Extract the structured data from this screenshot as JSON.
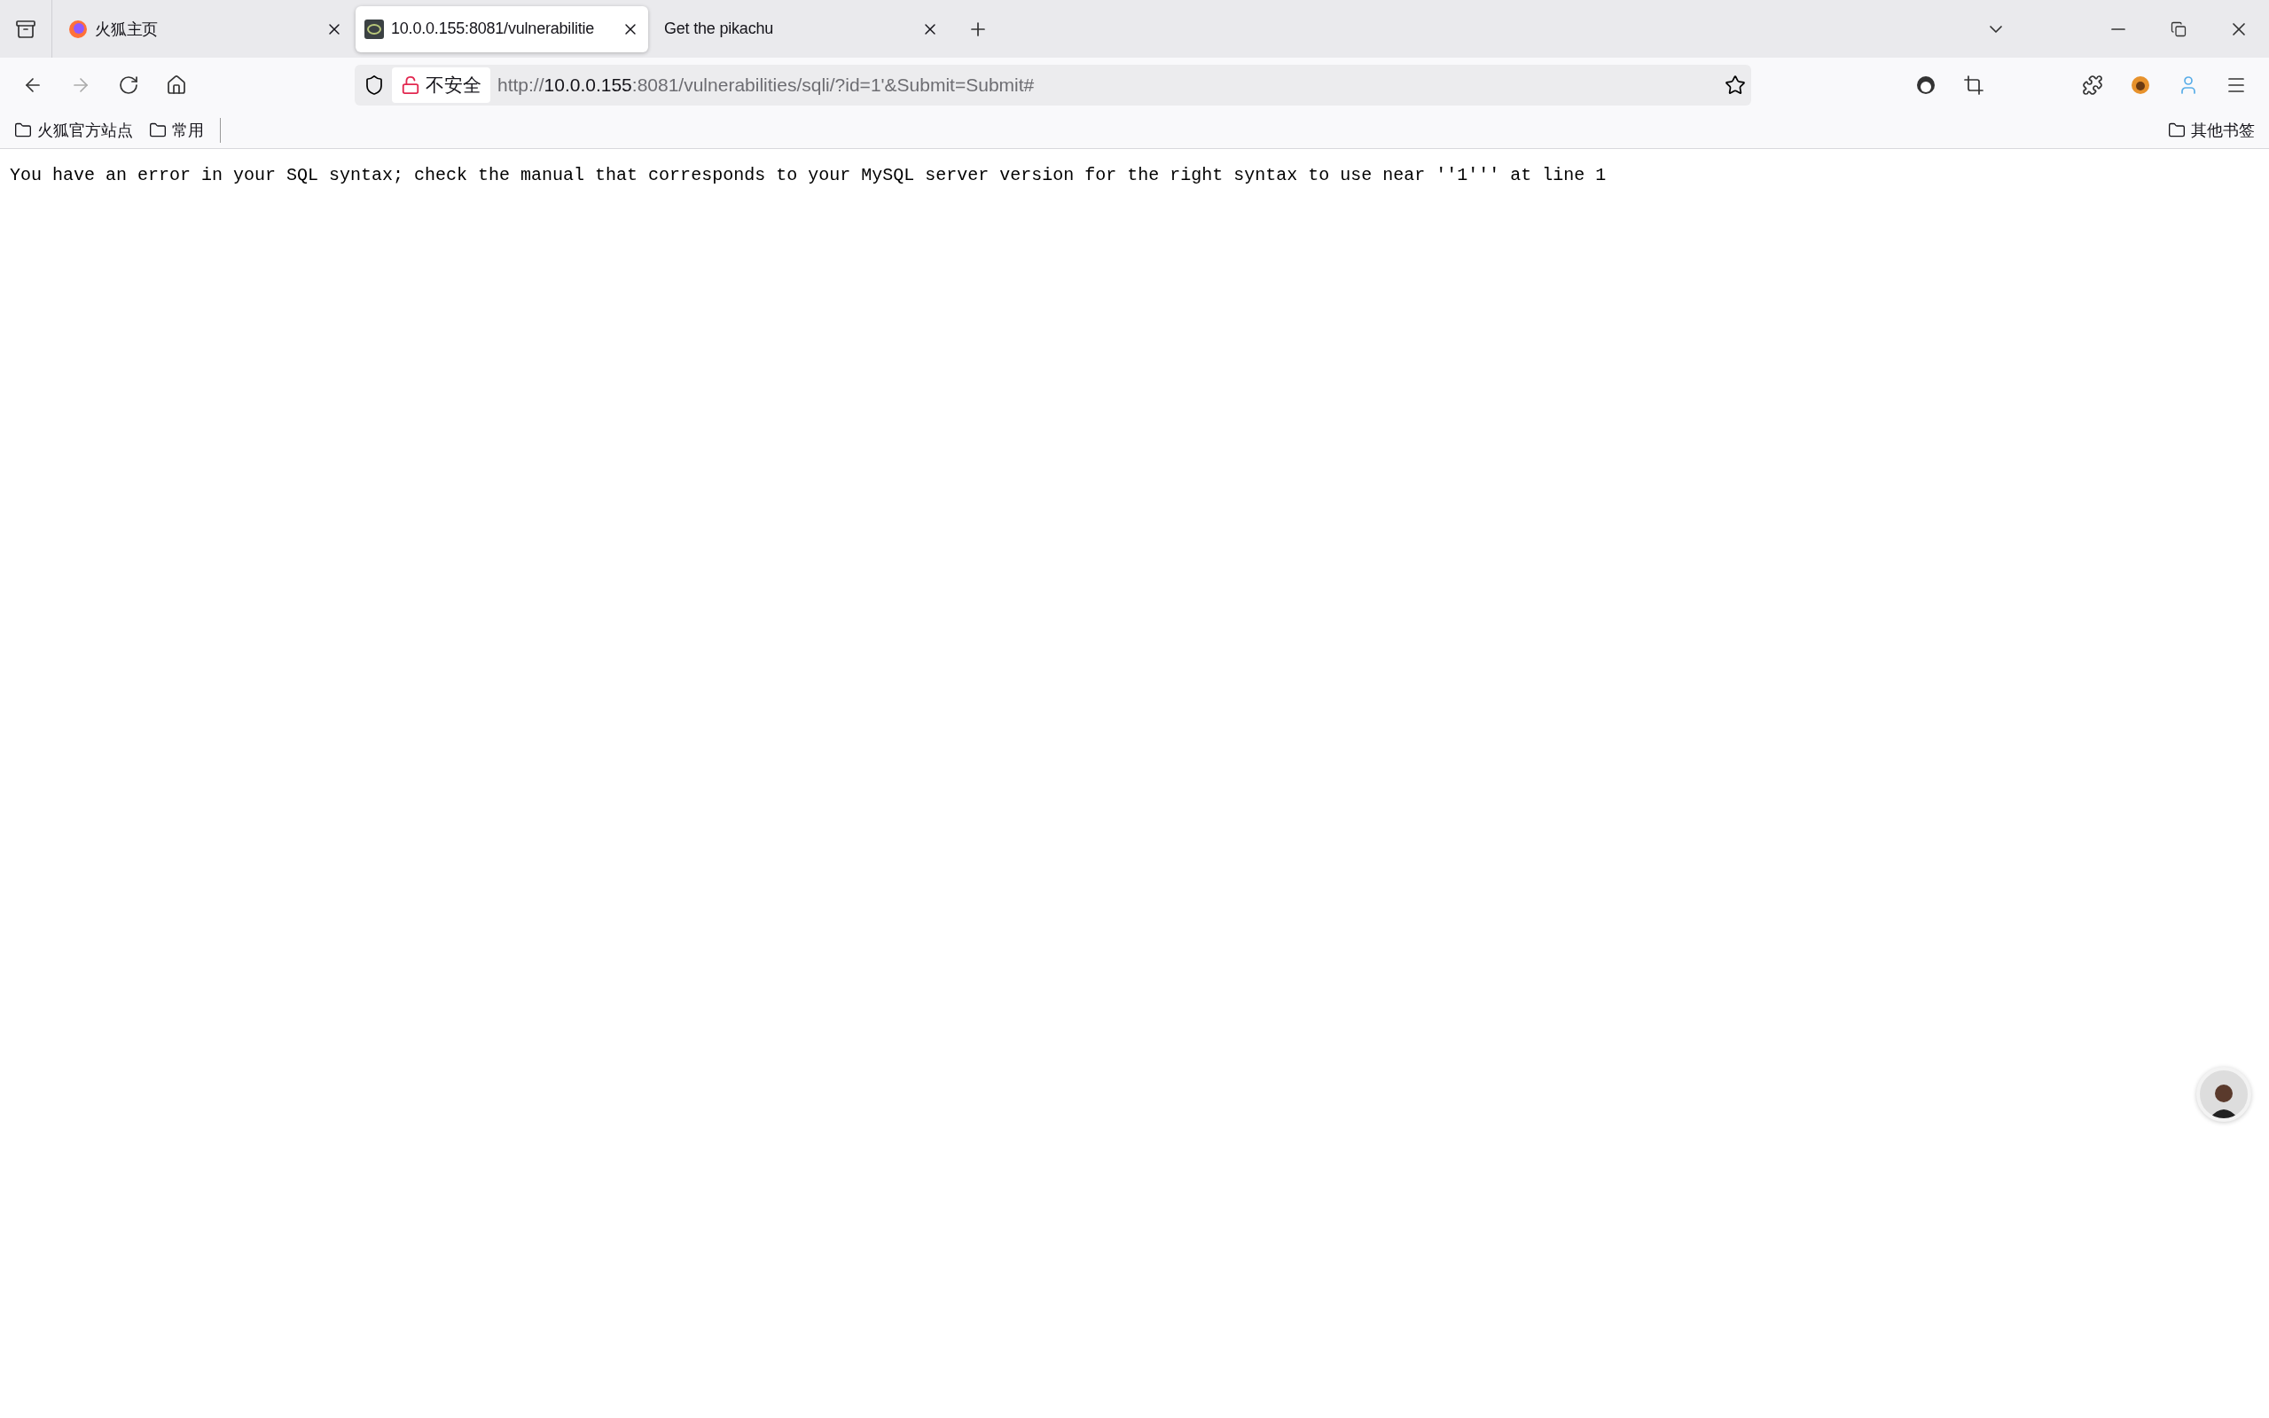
{
  "tabs": [
    {
      "title": "火狐主页",
      "kind": "firefox",
      "selected": false
    },
    {
      "title": "10.0.0.155:8081/vulnerabilitie",
      "kind": "site",
      "selected": true
    },
    {
      "title": "Get the pikachu",
      "kind": "plain",
      "selected": false
    }
  ],
  "address": {
    "security_label": "不安全",
    "url_prefix": "http://",
    "url_host": "10.0.0.155",
    "url_rest": ":8081/vulnerabilities/sqli/?id=1'&Submit=Submit#"
  },
  "bookmarks": [
    {
      "label": "火狐官方站点"
    },
    {
      "label": "常用"
    }
  ],
  "other_bookmarks": "其他书签",
  "page_text": "You have an error in your SQL syntax; check the manual that corresponds to your MySQL server version for the right syntax to use near ''1''' at line 1"
}
